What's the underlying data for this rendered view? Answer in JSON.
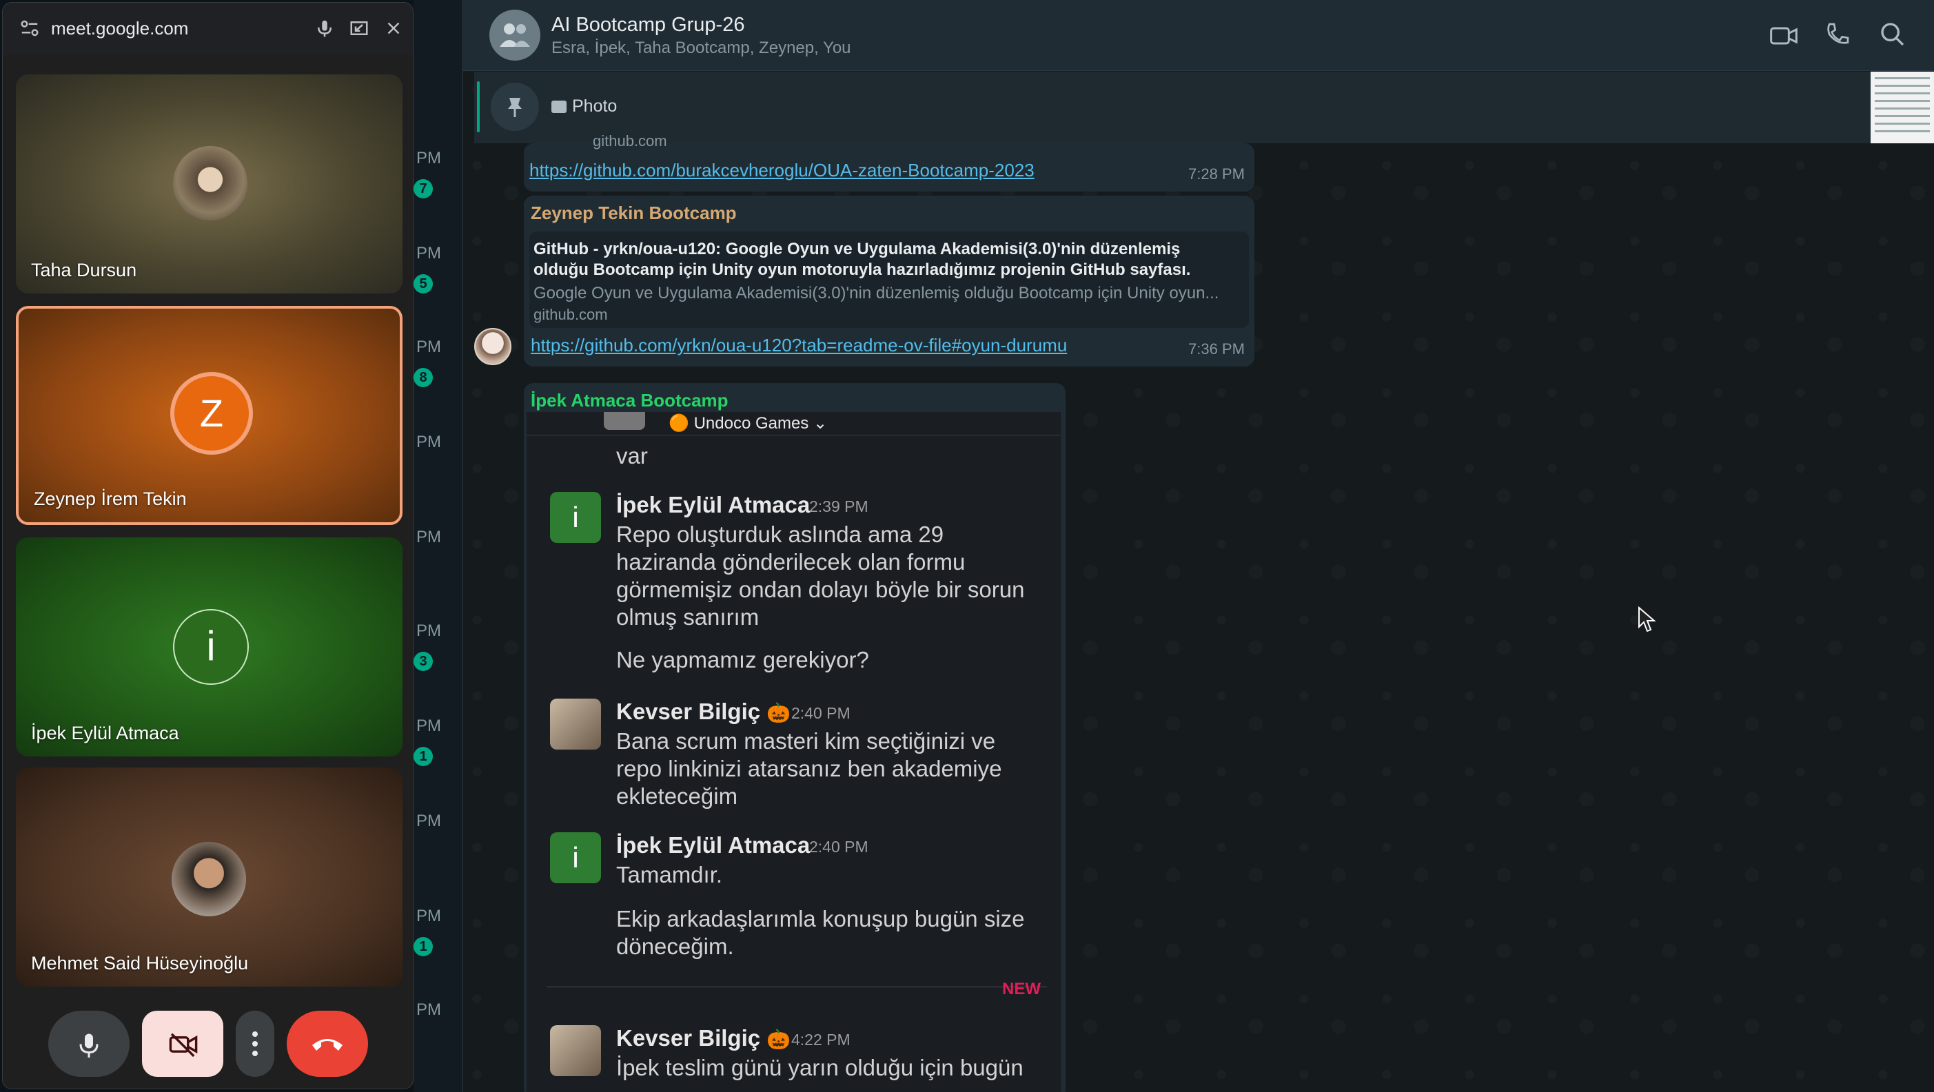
{
  "meet": {
    "url": "meet.google.com",
    "participants": [
      {
        "name": "Taha Dursun"
      },
      {
        "name": "Zeynep İrem Tekin",
        "initial": "Z"
      },
      {
        "name": "İpek Eylül Atmaca",
        "initial": "i"
      },
      {
        "name": "Mehmet Said Hüseyinoğlu"
      }
    ]
  },
  "chatlist": {
    "times": [
      "PM",
      "PM",
      "PM",
      "PM",
      "PM",
      "PM",
      "PM",
      "PM",
      "PM",
      "PM"
    ],
    "badges": [
      "7",
      "5",
      "8",
      "3",
      "1",
      "1"
    ]
  },
  "chat": {
    "group_name": "AI Bootcamp Grup-26",
    "members": "Esra, İpek, Taha Bootcamp, Zeynep, You",
    "pinned_label": "Photo",
    "messages": [
      {
        "cut_source": "github.com",
        "link": "https://github.com/burakcevheroglu/OUA-zaten-Bootcamp-2023",
        "time": "7:28 PM"
      },
      {
        "sender": "Zeynep Tekin Bootcamp",
        "preview_title_1": "GitHub - yrkn/oua-u120: Google Oyun ve Uygulama Akademisi(3.0)'nin düzenlemiş",
        "preview_title_2": "olduğu Bootcamp için Unity oyun motoruyla hazırladığımız projenin GitHub sayfası.",
        "preview_desc": "Google Oyun ve Uygulama Akademisi(3.0)'nin düzenlemiş olduğu Bootcamp için Unity oyun...",
        "preview_domain": "github.com",
        "link": "https://github.com/yrkn/oua-u120?tab=readme-ov-file#oyun-durumu",
        "time": "7:36 PM"
      },
      {
        "sender": "İpek Atmaca Bootcamp",
        "slack": {
          "workspace": "Undoco Games",
          "top_text": "var",
          "items": [
            {
              "author": "İpek Eylül Atmaca",
              "time": "2:39 PM",
              "lines": [
                "Repo oluşturduk aslında ama 29",
                "haziranda gönderilecek olan formu",
                "görmemişiz ondan dolayı böyle bir sorun",
                "olmuş sanırım"
              ],
              "extra": "Ne yapmamız gerekiyor?"
            },
            {
              "author": "Kevser Bilgiç",
              "emoji": "🎃",
              "time": "2:40 PM",
              "lines": [
                "Bana scrum masteri kim seçtiğinizi ve",
                "repo linkinizi atarsanız ben akademiye",
                "ekleteceğim"
              ]
            },
            {
              "author": "İpek Eylül Atmaca",
              "time": "2:40 PM",
              "lines": [
                "Tamamdır."
              ],
              "extra_lines": [
                "Ekip arkadaşlarımla konuşup bugün size",
                "döneceğim."
              ]
            },
            {
              "author": "Kevser Bilgiç",
              "emoji": "🎃",
              "time": "4:22 PM",
              "lines": [
                "İpek teslim günü yarın olduğu için bugün"
              ]
            }
          ],
          "new_label": "NEW"
        }
      }
    ]
  },
  "colors": {
    "accent": "#00a884",
    "link": "#53bdeb",
    "sender_zeynep": "#d6a974",
    "sender_ipek": "#25d366",
    "meet_hangup": "#ea4335",
    "active_speaker_border": "#f4a27a"
  }
}
